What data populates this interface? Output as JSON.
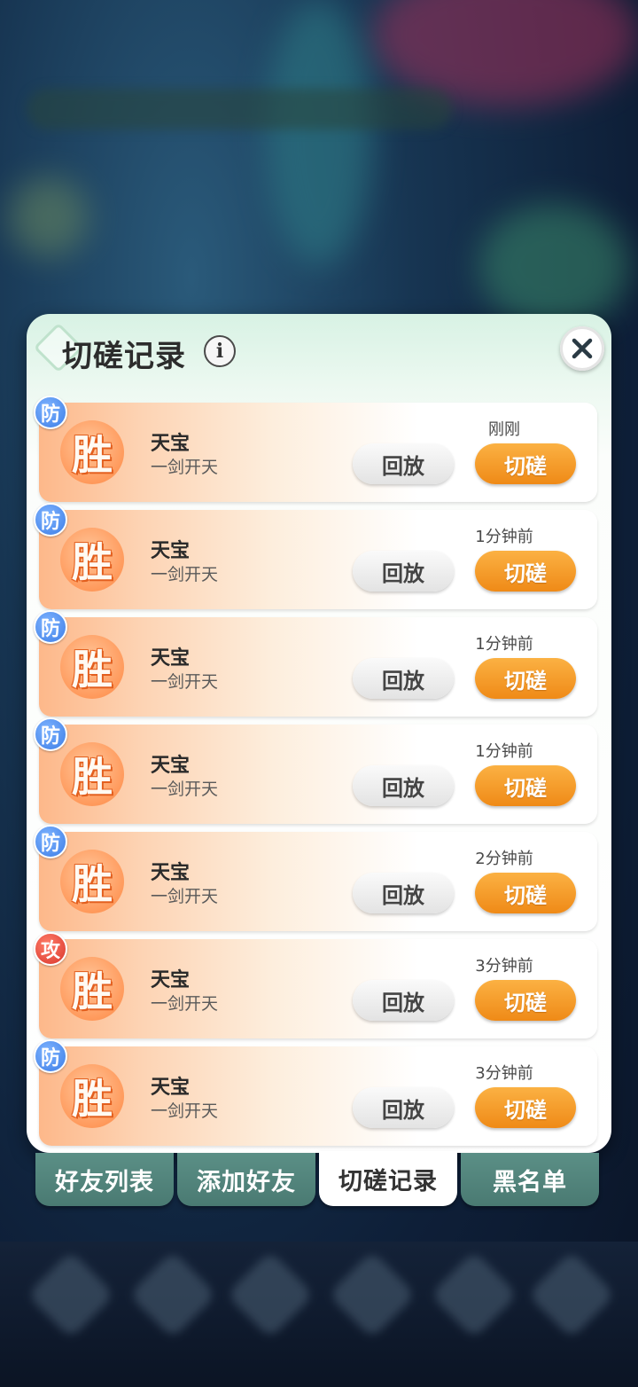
{
  "dialog": {
    "title": "切磋记录",
    "info_icon": "info-icon",
    "close_icon": "close-icon"
  },
  "records": [
    {
      "role": "防",
      "role_type": "defense",
      "result": "胜",
      "name": "天宝",
      "subtitle": "一剑开天",
      "time": "刚刚",
      "replay_label": "回放",
      "spar_label": "切磋"
    },
    {
      "role": "防",
      "role_type": "defense",
      "result": "胜",
      "name": "天宝",
      "subtitle": "一剑开天",
      "time": "1分钟前",
      "replay_label": "回放",
      "spar_label": "切磋"
    },
    {
      "role": "防",
      "role_type": "defense",
      "result": "胜",
      "name": "天宝",
      "subtitle": "一剑开天",
      "time": "1分钟前",
      "replay_label": "回放",
      "spar_label": "切磋"
    },
    {
      "role": "防",
      "role_type": "defense",
      "result": "胜",
      "name": "天宝",
      "subtitle": "一剑开天",
      "time": "1分钟前",
      "replay_label": "回放",
      "spar_label": "切磋"
    },
    {
      "role": "防",
      "role_type": "defense",
      "result": "胜",
      "name": "天宝",
      "subtitle": "一剑开天",
      "time": "2分钟前",
      "replay_label": "回放",
      "spar_label": "切磋"
    },
    {
      "role": "攻",
      "role_type": "attack",
      "result": "胜",
      "name": "天宝",
      "subtitle": "一剑开天",
      "time": "3分钟前",
      "replay_label": "回放",
      "spar_label": "切磋"
    },
    {
      "role": "防",
      "role_type": "defense",
      "result": "胜",
      "name": "天宝",
      "subtitle": "一剑开天",
      "time": "3分钟前",
      "replay_label": "回放",
      "spar_label": "切磋"
    }
  ],
  "tabs": [
    {
      "label": "好友列表",
      "active": false
    },
    {
      "label": "添加好友",
      "active": false
    },
    {
      "label": "切磋记录",
      "active": true
    },
    {
      "label": "黑名单",
      "active": false
    }
  ],
  "colors": {
    "spar_button": "#ef8a17",
    "defense_badge": "#3c7de6",
    "attack_badge": "#d9342b",
    "tab_inactive": "#4a7a72"
  }
}
